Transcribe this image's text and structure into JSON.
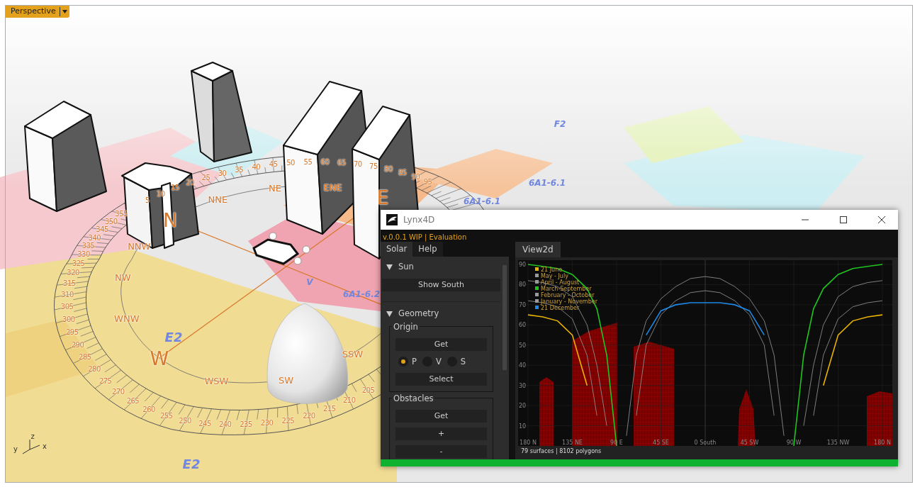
{
  "viewport": {
    "title": "Perspective",
    "compass_points": [
      "N",
      "NNE",
      "NE",
      "ENE",
      "E",
      "SSW",
      "SW",
      "WSW",
      "W",
      "WNW",
      "NW",
      "NNW"
    ],
    "degree_labels_north": [
      "5",
      "10",
      "15",
      "20",
      "25",
      "30",
      "35",
      "40",
      "45",
      "50",
      "55",
      "60",
      "65",
      "70",
      "75",
      "80",
      "85",
      "90",
      "95"
    ],
    "degree_labels_south": [
      "355",
      "350",
      "345",
      "340",
      "335",
      "330",
      "325",
      "320",
      "315",
      "310",
      "305",
      "300",
      "295",
      "290",
      "285",
      "280",
      "275",
      "270",
      "265",
      "260",
      "255",
      "250",
      "245",
      "240",
      "235",
      "230",
      "225",
      "220",
      "215",
      "210",
      "205"
    ],
    "map_labels": [
      "E2",
      "E2",
      "6A1-6.2",
      "6A1-6.1",
      "6A1-6.1",
      "V",
      "F2"
    ],
    "axis_labels": [
      "y",
      "z",
      "x"
    ]
  },
  "lynx_window": {
    "title": "Lynx4D",
    "version": "v.0.0.1 WIP | Evaluation",
    "tabs": [
      {
        "label": "Solar",
        "selected": true
      },
      {
        "label": "Help",
        "selected": false
      }
    ],
    "sections": [
      {
        "title": "Sun",
        "expanded": true,
        "items": [
          {
            "kind": "button",
            "label": "Show South"
          }
        ]
      },
      {
        "title": "Geometry",
        "expanded": true,
        "items": [
          {
            "kind": "group",
            "title": "Origin",
            "items": [
              {
                "kind": "button",
                "label": "Get"
              },
              {
                "kind": "radios",
                "options": [
                  {
                    "label": "P",
                    "selected": true
                  },
                  {
                    "label": "V",
                    "selected": false
                  },
                  {
                    "label": "S",
                    "selected": false
                  }
                ]
              },
              {
                "kind": "button",
                "label": "Select"
              }
            ]
          },
          {
            "kind": "group",
            "title": "Obstacles",
            "items": [
              {
                "kind": "button",
                "label": "Get"
              },
              {
                "kind": "button",
                "label": "+"
              },
              {
                "kind": "button",
                "label": "-"
              }
            ]
          }
        ]
      }
    ],
    "view_tabs": [
      {
        "label": "View2d",
        "selected": true
      }
    ],
    "chart_data": {
      "type": "line",
      "x": [
        -180,
        -165,
        -150,
        -135,
        -120,
        -110,
        -100,
        -90,
        -80,
        -70,
        -60,
        -45,
        -30,
        -15,
        0,
        15,
        30,
        45,
        60,
        70,
        80,
        90,
        100,
        110,
        120,
        135,
        150,
        165,
        180
      ],
      "xlim": [
        -180,
        180
      ],
      "ylim": [
        0,
        90
      ],
      "grid": true,
      "legend": true,
      "xticks": [
        {
          "value": -180,
          "label": "180 N"
        },
        {
          "value": -135,
          "label": "135 NE"
        },
        {
          "value": -90,
          "label": "90 E"
        },
        {
          "value": -45,
          "label": "45 SE"
        },
        {
          "value": 0,
          "label": "0 South"
        },
        {
          "value": 45,
          "label": "45 SW"
        },
        {
          "value": 90,
          "label": "90 W"
        },
        {
          "value": 135,
          "label": "135 NW"
        },
        {
          "value": 180,
          "label": "180 N"
        }
      ],
      "yticks": [
        10,
        20,
        30,
        40,
        50,
        60,
        70,
        80,
        90
      ],
      "series": [
        {
          "name": "21 June",
          "color": "#e8b400",
          "values": [
            65,
            64,
            62,
            55,
            30,
            null,
            null,
            null,
            null,
            null,
            null,
            null,
            null,
            null,
            null,
            null,
            null,
            null,
            null,
            null,
            null,
            null,
            null,
            null,
            30,
            55,
            62,
            64,
            65
          ]
        },
        {
          "name": "May - July",
          "color": "#9a9a9a",
          "values": [
            72,
            71,
            69,
            63,
            45,
            15,
            null,
            null,
            null,
            null,
            null,
            null,
            null,
            null,
            null,
            null,
            null,
            null,
            null,
            null,
            null,
            null,
            null,
            15,
            45,
            63,
            69,
            71,
            72
          ]
        },
        {
          "name": "April - August",
          "color": "#9a9a9a",
          "values": [
            82,
            81,
            79,
            74,
            60,
            40,
            10,
            null,
            null,
            null,
            null,
            null,
            null,
            null,
            null,
            null,
            null,
            null,
            null,
            null,
            null,
            null,
            10,
            40,
            60,
            74,
            79,
            81,
            82
          ]
        },
        {
          "name": "March-September",
          "color": "#1fc41f",
          "values": [
            90,
            89,
            88,
            85,
            78,
            68,
            45,
            0,
            null,
            null,
            null,
            null,
            null,
            null,
            null,
            null,
            null,
            null,
            null,
            null,
            null,
            0,
            45,
            68,
            78,
            85,
            88,
            89,
            90
          ]
        },
        {
          "name": "February - October",
          "color": "#9a9a9a",
          "values": [
            null,
            null,
            null,
            null,
            null,
            null,
            null,
            null,
            5,
            45,
            62,
            73,
            79,
            83,
            84,
            83,
            79,
            73,
            62,
            45,
            5,
            null,
            null,
            null,
            null,
            null,
            null,
            null,
            null
          ]
        },
        {
          "name": "January - November",
          "color": "#9a9a9a",
          "values": [
            null,
            null,
            null,
            null,
            null,
            null,
            null,
            null,
            null,
            15,
            50,
            65,
            72,
            76,
            77,
            76,
            72,
            65,
            50,
            15,
            null,
            null,
            null,
            null,
            null,
            null,
            null,
            null,
            null
          ]
        },
        {
          "name": "21 December",
          "color": "#1e88e5",
          "values": [
            null,
            null,
            null,
            null,
            null,
            null,
            null,
            null,
            null,
            null,
            55,
            67,
            70,
            71,
            71,
            71,
            70,
            67,
            55,
            null,
            null,
            null,
            null,
            null,
            null,
            null,
            null,
            null,
            null
          ]
        }
      ]
    },
    "status": "79 surfaces | 8102 polygons",
    "progress": {
      "level": 1
    }
  }
}
